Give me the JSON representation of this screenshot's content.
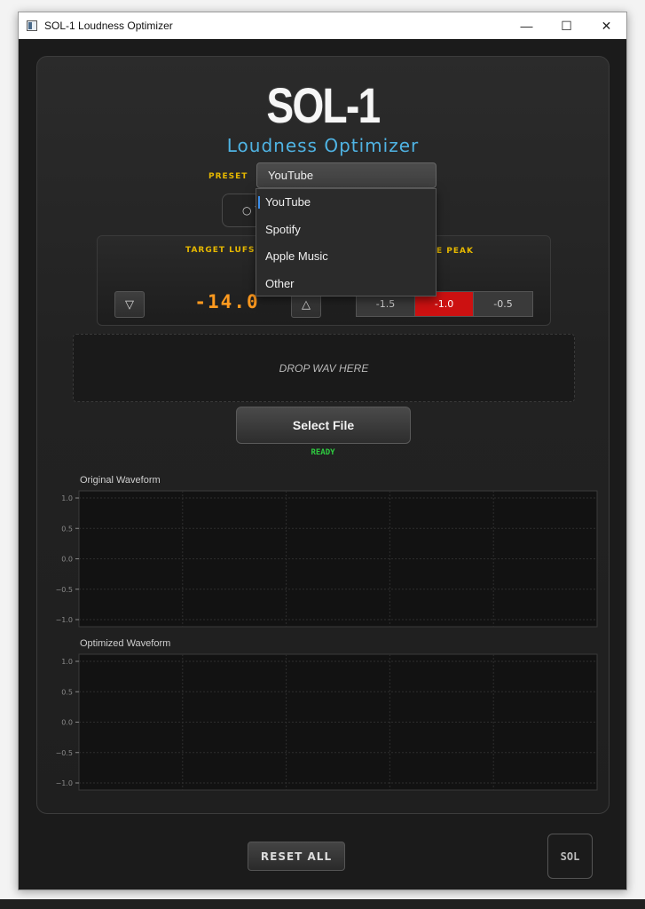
{
  "window": {
    "title": "SOL-1 Loudness Optimizer",
    "minimize": "—",
    "maximize": "☐",
    "close": "✕"
  },
  "app": {
    "logo": "SOL-1",
    "subtitle": "Loudness Optimizer"
  },
  "preset": {
    "label": "PRESET",
    "selected": "YouTube",
    "options": [
      "YouTube",
      "Spotify",
      "Apple Music",
      "Other"
    ]
  },
  "mode_toggle": {
    "label": "○ V"
  },
  "target": {
    "label": "TARGET LUFS",
    "value": "-14.0",
    "decrement": "▽",
    "increment": "△"
  },
  "peak": {
    "label": "E PEAK",
    "options": [
      "-1.5",
      "-1.0",
      "-0.5"
    ],
    "selected": "-1.0"
  },
  "dropzone": {
    "text": "DROP WAV HERE"
  },
  "select_file": "Select File",
  "status": "READY",
  "plots": [
    {
      "title": "Original Waveform",
      "yticks": [
        "1.0",
        "0.5",
        "0.0",
        "−0.5",
        "−1.0"
      ]
    },
    {
      "title": "Optimized Waveform",
      "yticks": [
        "1.0",
        "0.5",
        "0.0",
        "−0.5",
        "−1.0"
      ]
    }
  ],
  "reset_all": "RESET ALL",
  "badge": "SOL",
  "colors": {
    "accent_blue": "#4fb3e3",
    "label_yellow": "#e6b800",
    "lufs_orange": "#ff9a1f",
    "active_red": "#cc1111",
    "status_green": "#2ecc40"
  }
}
